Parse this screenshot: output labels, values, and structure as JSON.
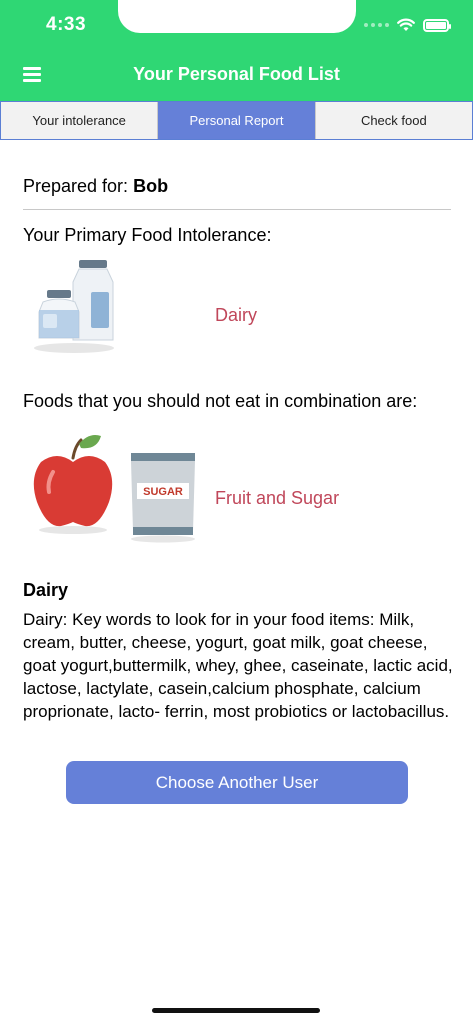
{
  "status": {
    "time": "4:33"
  },
  "header": {
    "title": "Your Personal Food List",
    "menu_icon": "hamburger-menu-icon"
  },
  "tabs": [
    {
      "label": "Your intolerance",
      "active": false
    },
    {
      "label": "Personal Report",
      "active": true
    },
    {
      "label": "Check food",
      "active": false
    }
  ],
  "report": {
    "prepared_label": "Prepared for:",
    "user_name": "Bob",
    "primary_label": "Your Primary Food Intolerance:",
    "primary_intolerance": "Dairy",
    "combo_label": "Foods that you should not eat in combination are:",
    "combo_foods": "Fruit and Sugar",
    "sugar_pack_label": "SUGAR",
    "detail_title": "Dairy",
    "detail_body": "Dairy: Key words to look for in your food items: Milk, cream, butter, cheese, yogurt, goat milk, goat cheese, goat yogurt,buttermilk, whey, ghee, caseinate, lactic acid, lactose, lactylate, casein,calcium phosphate, calcium proprionate, lacto- ferrin, most probiotics or lactobacillus."
  },
  "actions": {
    "choose_user": "Choose Another User"
  },
  "colors": {
    "header": "#2fd774",
    "accent": "#6580d8",
    "highlight_text": "#c0475a"
  }
}
